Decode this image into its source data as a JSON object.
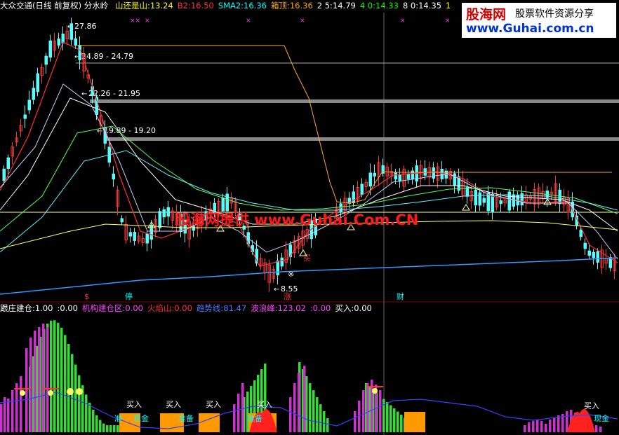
{
  "header_main": {
    "title": "大众交通(日线 前复权) 分水岭",
    "items": [
      {
        "label": "山还是山:",
        "value": "13.24",
        "color": "#ffff00"
      },
      {
        "label": "B2:",
        "value": "16.50",
        "color": "#ff3333"
      },
      {
        "label": "SMA2:",
        "value": "16.36",
        "color": "#00ffff"
      },
      {
        "label": "箱顶:",
        "value": "16.36",
        "color": "#ffaa00"
      },
      {
        "label": "2 5:",
        "value": "14.79",
        "color": "#ffffff"
      },
      {
        "label": "4 0:",
        "value": "14.33",
        "color": "#00ff00"
      },
      {
        "label": "8 0:",
        "value": "14.35",
        "color": "#ffffff"
      },
      {
        "label": "1",
        "value": "",
        "color": "#ffff00"
      }
    ]
  },
  "header_sub": {
    "items": [
      {
        "label": "跟庄建仓:",
        "value": "1.00",
        "color": "#ffffff"
      },
      {
        "label": ":",
        "value": "0.00",
        "color": "#ffffff"
      },
      {
        "label": "机构建仓区:",
        "value": "0.00",
        "color": "#ff44ff"
      },
      {
        "label": "火焰山:",
        "value": "0.00",
        "color": "#ff3333"
      },
      {
        "label": "趋势线:",
        "value": "81.47",
        "color": "#5577ff"
      },
      {
        "label": "波浪峰:",
        "value": "123.02",
        "color": "#ff44ff"
      },
      {
        "label": ":",
        "value": "0.00",
        "color": "#ff44ff"
      },
      {
        "label": "买入:",
        "value": "0.00",
        "color": "#ffffff"
      }
    ]
  },
  "logo": {
    "brand": "股海网",
    "tagline": "股票软件资源分享",
    "url": "www.Guhai.com.cn"
  },
  "watermark": "股海网提供 www.Guhai.Com.CN",
  "colors": {
    "up": "#ff3232",
    "down": "#54ffff",
    "bg": "#000000",
    "grid": "#800000"
  },
  "chart_data": [
    {
      "type": "candlestick",
      "price_labels": [
        "27.86",
        "24.89 - 24.79",
        "22.26 - 21.95",
        "19.89 - 19.20",
        "8.55"
      ],
      "levels": [
        24.79,
        21.95,
        19.2
      ],
      "markers": [
        {
          "text": "$",
          "color": "#ff3333"
        },
        {
          "text": "停",
          "color": "#00ffff"
        },
        {
          "text": "涨",
          "color": "#ff3333"
        },
        {
          "text": "财",
          "color": "#00ffff"
        },
        {
          "text": "买",
          "color": "#ff3333"
        },
        {
          "text": "※",
          "color": "#ffffff"
        }
      ],
      "top_marks": [
        "××",
        "×",
        "×",
        "×",
        "×",
        "×"
      ]
    },
    {
      "type": "bar",
      "labels": [
        "买入",
        "买入",
        "买入",
        "买入",
        "买入",
        "准",
        "现金",
        "准备",
        "准备",
        "现金"
      ]
    }
  ]
}
